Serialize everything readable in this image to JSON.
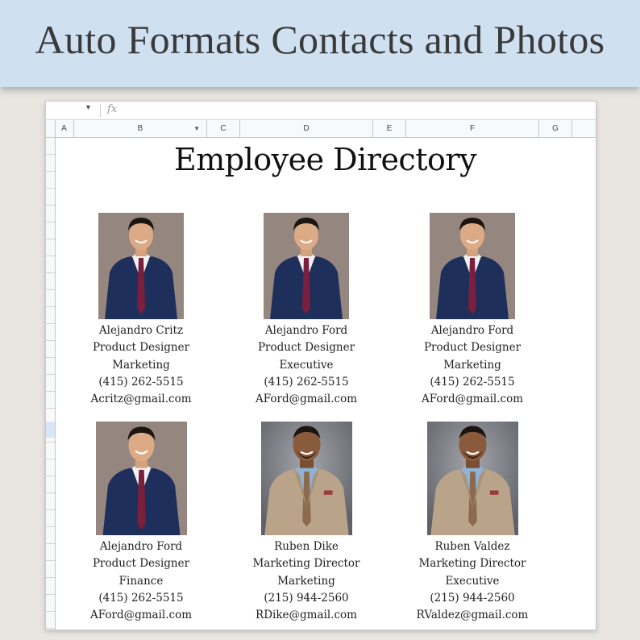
{
  "banner": {
    "title": "Auto Formats Contacts and Photos"
  },
  "toolbar": {
    "fx_label": "fx"
  },
  "columns": [
    "A",
    "B",
    "C",
    "D",
    "E",
    "F",
    "G"
  ],
  "sheet": {
    "title": "Employee Directory"
  },
  "employees": [
    {
      "name": "Alejandro Critz",
      "title": "Product Designer",
      "department": "Marketing",
      "phone": "(415) 262-5515",
      "email": "Acritz@gmail.com",
      "photo": "asian-man-navy-suit-portrait"
    },
    {
      "name": "Alejandro Ford",
      "title": "Product Designer",
      "department": "Executive",
      "phone": "(415) 262-5515",
      "email": "AFord@gmail.com",
      "photo": "asian-man-navy-suit-portrait"
    },
    {
      "name": "Alejandro Ford",
      "title": "Product Designer",
      "department": "Marketing",
      "phone": "(415) 262-5515",
      "email": "AFord@gmail.com",
      "photo": "asian-man-navy-suit-portrait"
    },
    {
      "name": "Alejandro Ford",
      "title": "Product Designer",
      "department": "Finance",
      "phone": "(415) 262-5515",
      "email": "AFord@gmail.com",
      "photo": "asian-man-navy-suit-portrait"
    },
    {
      "name": "Ruben Dike",
      "title": "Marketing Director",
      "department": "Marketing",
      "phone": "(215) 944-2560",
      "email": "RDike@gmail.com",
      "photo": "man-tan-suit-portrait"
    },
    {
      "name": "Ruben Valdez",
      "title": "Marketing Director",
      "department": "Executive",
      "phone": "(215) 944-2560",
      "email": "RValdez@gmail.com",
      "photo": "man-tan-suit-portrait"
    }
  ],
  "colors": {
    "banner_bg": "#cfe0f1",
    "navy_suit": "#1f2f5c",
    "maroon_tie": "#7a1f3d",
    "tan_suit": "#b9a48a",
    "blue_shirt": "#8fb2d6",
    "photo_bg_warm": "#8d7f78",
    "photo_bg_gray": "#7d7f86"
  }
}
